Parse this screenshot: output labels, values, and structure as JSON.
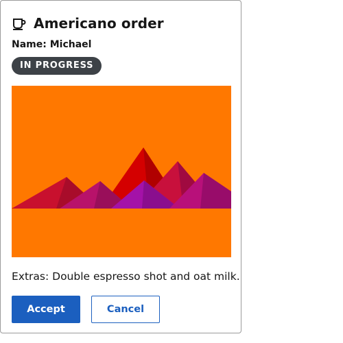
{
  "order": {
    "title": "Americano order",
    "icon": "coffee-cup-icon",
    "name_line": "Name: Michael",
    "status": "IN PROGRESS",
    "extras": "Extras: Double espresso shot and oat milk."
  },
  "image": {
    "description_icon": "mountain-landscape-image",
    "background_color": "#ff7800"
  },
  "actions": {
    "accept_label": "Accept",
    "cancel_label": "Cancel"
  },
  "colors": {
    "primary": "#1b5fbf",
    "badge_bg": "#3d4247",
    "card_border": "#9a9a9a"
  }
}
